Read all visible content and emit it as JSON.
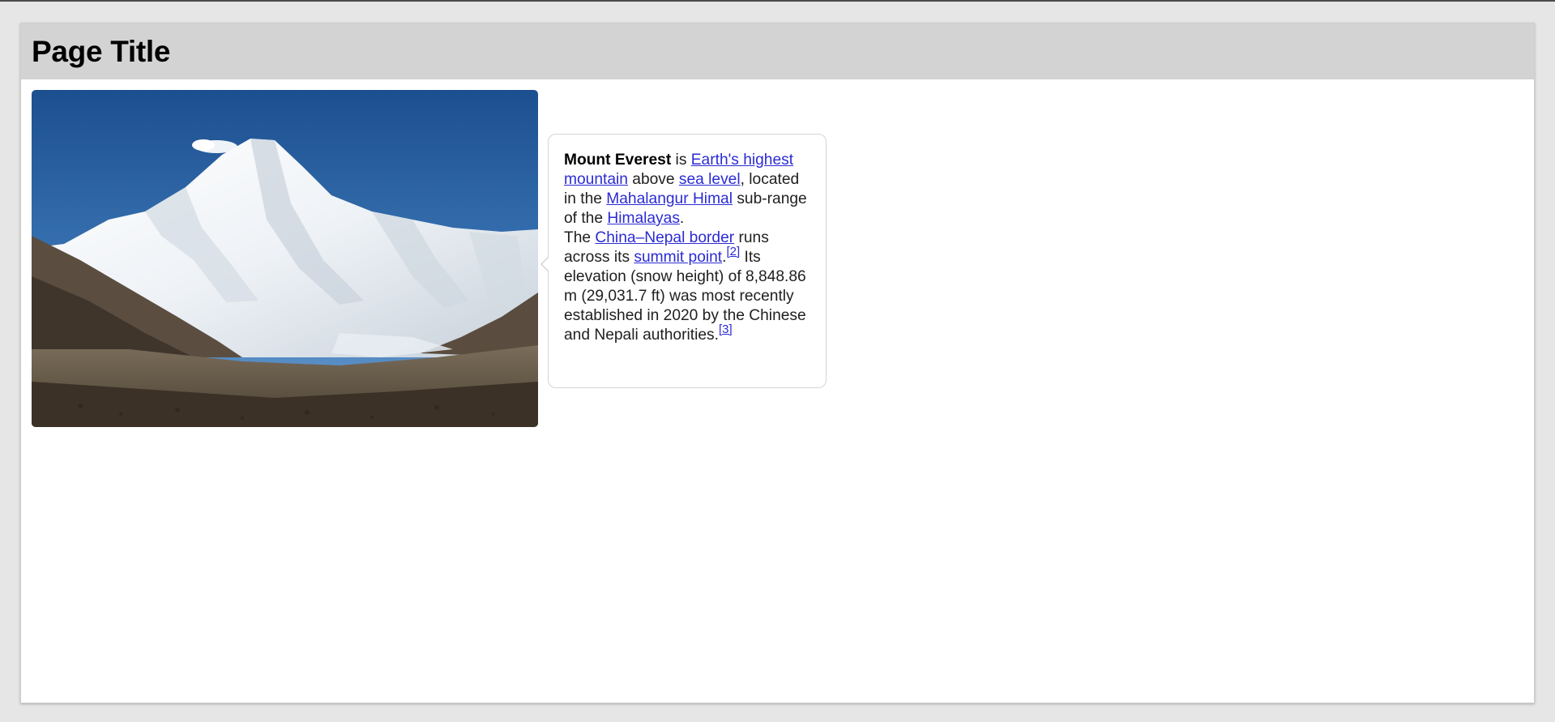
{
  "page": {
    "title": "Page Title"
  },
  "image": {
    "alt": "Mount Everest"
  },
  "bubble": {
    "subject": "Mount Everest",
    "t_is": " is ",
    "link_earths_highest": "Earth's highest mountain",
    "t_above": " above ",
    "link_sea_level": "sea level",
    "t_located": ", located in the ",
    "link_mahalangur": "Mahalangur Himal",
    "t_subrange": " sub-range of the ",
    "link_himalayas": "Himalayas",
    "t_period1": ".",
    "t_the": "The ",
    "link_border": "China–Nepal border",
    "t_runs": " runs across its ",
    "link_summit": "summit point",
    "t_period2": ".",
    "ref_2": "[2]",
    "t_elevation": " Its elevation (snow height) of 8,848.86 m (29,031.7 ft) was most recently established in 2020 by the Chinese and Nepali authorities.",
    "ref_3": "[3]"
  },
  "colors": {
    "background": "#e6e6e6",
    "header": "#d3d3d3",
    "link": "#2b2bd4"
  }
}
